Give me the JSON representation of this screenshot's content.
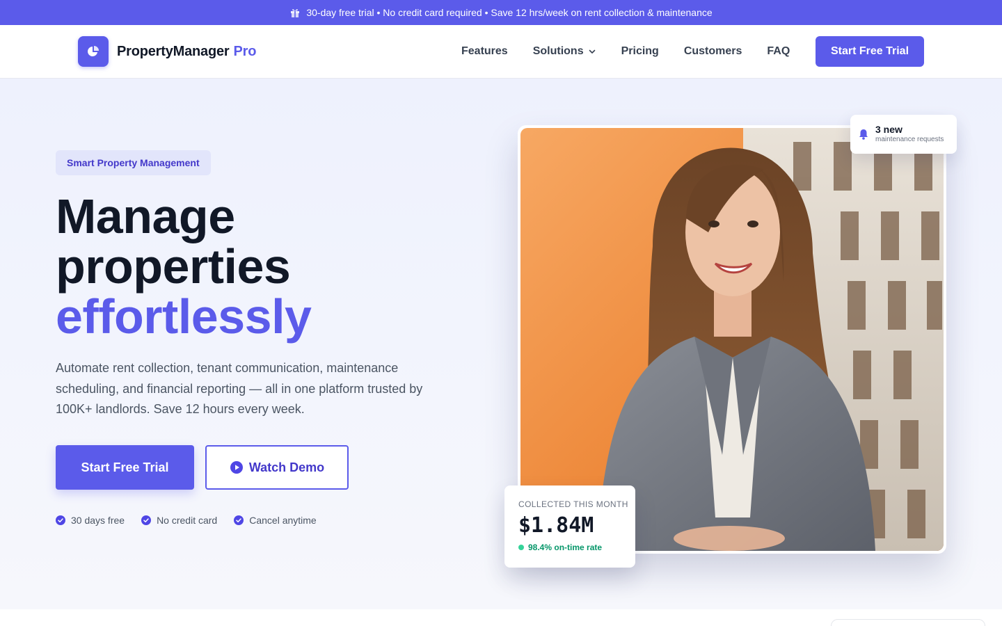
{
  "announcement": {
    "icon": "gift-icon",
    "text": "30-day free trial • No credit card required • Save 12 hrs/week on rent collection & maintenance"
  },
  "nav": {
    "brand_name": "PropertyManager",
    "brand_suffix": "Pro",
    "logo_icon": "pie-chart-icon",
    "items": [
      {
        "label": "Features"
      },
      {
        "label": "Solutions",
        "has_dropdown": true
      },
      {
        "label": "Pricing"
      },
      {
        "label": "Customers"
      },
      {
        "label": "FAQ"
      }
    ],
    "cta_label": "Start Free Trial"
  },
  "hero": {
    "badge": "Smart Property Management",
    "headline_line1": "Manage",
    "headline_line2": "properties",
    "headline_accent": "effortlessly",
    "lead": "Automate rent collection, tenant communication, maintenance scheduling, and financial reporting — all in one platform trusted by 100K+ landlords. Save 12 hours every week.",
    "primary_cta": "Start Free Trial",
    "secondary_cta": "Watch Demo",
    "perks": [
      "30 days free",
      "No credit card",
      "Cancel anytime"
    ]
  },
  "notification": {
    "icon": "bell-icon",
    "title": "3 new",
    "subtitle": "maintenance requests"
  },
  "stat": {
    "label": "COLLECTED THIS MONTH",
    "value": "$1.84M",
    "rate": "98.4% on-time rate"
  },
  "colors": {
    "accent": "#5b5bea",
    "accent_dark": "#4338ca",
    "success": "#059669",
    "heading": "#111827"
  }
}
